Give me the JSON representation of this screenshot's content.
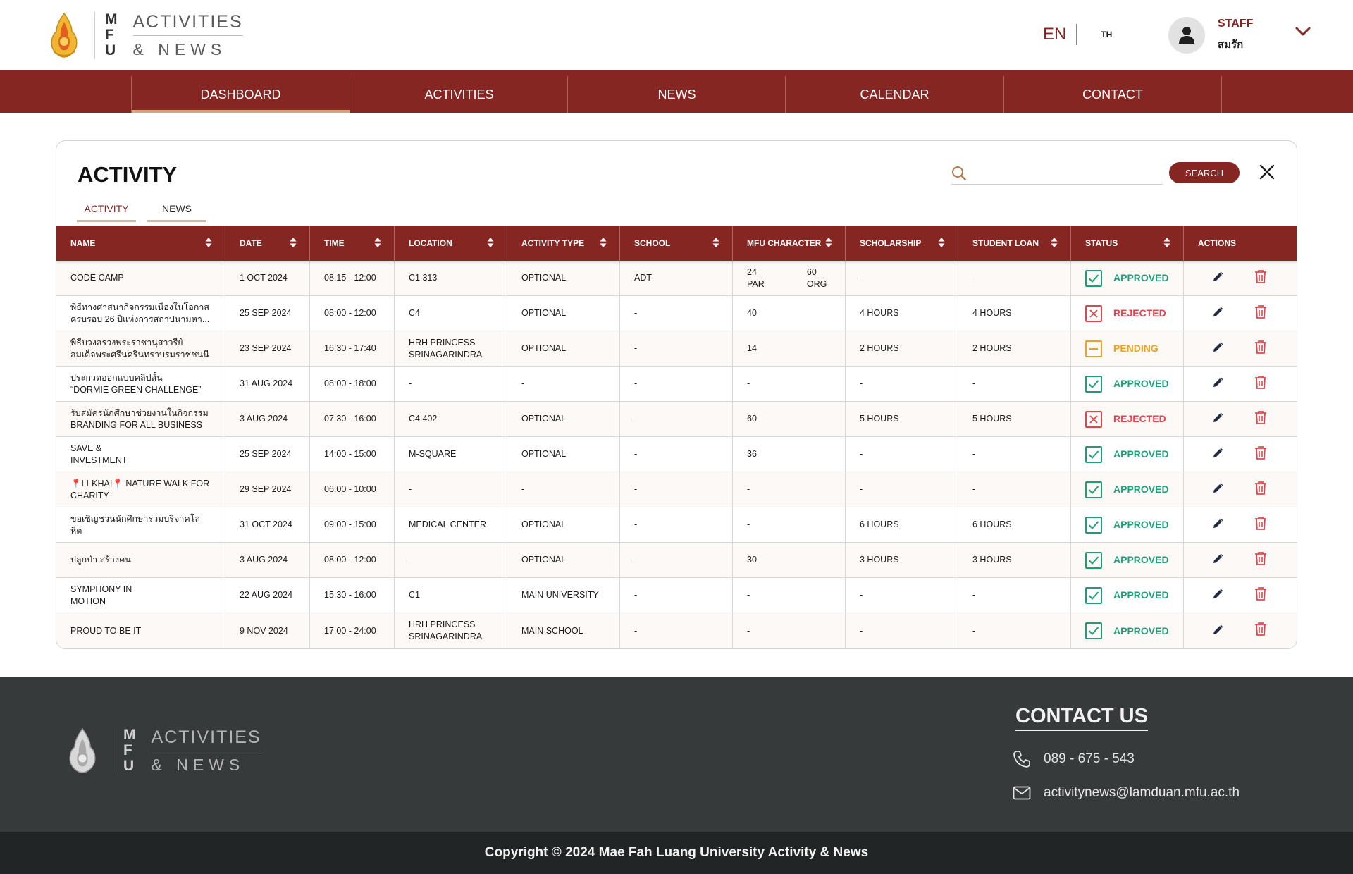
{
  "header": {
    "logo": {
      "letters": [
        "M",
        "F",
        "U"
      ],
      "line1": "ACTIVITIES",
      "line2": "& NEWS"
    },
    "lang": {
      "en": "EN",
      "th": "TH"
    },
    "user": {
      "role": "STAFF",
      "name": "สมรัก"
    }
  },
  "nav": [
    "DASHBOARD",
    "ACTIVITIES",
    "NEWS",
    "CALENDAR",
    "CONTACT"
  ],
  "nav_active": "DASHBOARD",
  "card": {
    "title": "ACTIVITY",
    "search": {
      "placeholder": "",
      "button": "SEARCH"
    },
    "tabs": [
      "ACTIVITY",
      "NEWS"
    ],
    "active_tab": "ACTIVITY"
  },
  "table": {
    "columns": [
      "NAME",
      "DATE",
      "TIME",
      "LOCATION",
      "ACTIVITY TYPE",
      "SCHOOL",
      "MFU CHARACTER",
      "SCHOLARSHIP",
      "STUDENT LOAN",
      "STATUS",
      "ACTIONS"
    ],
    "rows": [
      {
        "name": [
          "CODE CAMP"
        ],
        "date": "1 OCT 2024",
        "time": "08:15 - 12:00",
        "location": [
          "C1 313"
        ],
        "type": "OPTIONAL",
        "school": "ADT",
        "character": [
          "24 PAR",
          "60 ORG"
        ],
        "scholarship": "-",
        "loan": "-",
        "status": "APPROVED"
      },
      {
        "name": [
          "พิธีทางศาสนากิจกรรมเนื่องในโอกาส",
          "ครบรอบ 26 ปีแห่งการสถาปนามหา..."
        ],
        "date": "25 SEP 2024",
        "time": "08:00 - 12:00",
        "location": [
          "C4"
        ],
        "type": "OPTIONAL",
        "school": "-",
        "character": [
          "40"
        ],
        "scholarship": "4 HOURS",
        "loan": "4 HOURS",
        "status": "REJECTED"
      },
      {
        "name": [
          "พิธีบวงสรวงพระราชานุสาวรีย์",
          "สมเด็จพระศรีนครินทราบรมราชชนนี"
        ],
        "date": "23 SEP 2024",
        "time": "16:30 - 17:40",
        "location": [
          "HRH PRINCESS",
          "SRINAGARINDRA"
        ],
        "type": "OPTIONAL",
        "school": "-",
        "character": [
          "14"
        ],
        "scholarship": "2 HOURS",
        "loan": "2 HOURS",
        "status": "PENDING"
      },
      {
        "name": [
          "ประกวดออกแบบคลิปสั้น",
          "“DORMIE GREEN CHALLENGE”"
        ],
        "date": "31 AUG 2024",
        "time": "08:00 - 18:00",
        "location": [
          "-"
        ],
        "type": "-",
        "school": "-",
        "character": [
          "-"
        ],
        "scholarship": "-",
        "loan": "-",
        "status": "APPROVED"
      },
      {
        "name": [
          "รับสมัครนักศึกษาช่วยงานในกิจกรรม",
          "BRANDING FOR ALL BUSINESS"
        ],
        "date": "3 AUG 2024",
        "time": "07:30 - 16:00",
        "location": [
          "C4 402"
        ],
        "type": "OPTIONAL",
        "school": "-",
        "character": [
          "60"
        ],
        "scholarship": "5 HOURS",
        "loan": "5 HOURS",
        "status": "REJECTED"
      },
      {
        "name": [
          "SAVE &",
          "INVESTMENT"
        ],
        "date": "25 SEP 2024",
        "time": "14:00 - 15:00",
        "location": [
          "M-SQUARE"
        ],
        "type": "OPTIONAL",
        "school": "-",
        "character": [
          "36"
        ],
        "scholarship": "-",
        "loan": "-",
        "status": "APPROVED"
      },
      {
        "name": [
          "📍LI-KHAI📍 NATURE WALK FOR",
          "CHARITY"
        ],
        "date": "29 SEP 2024",
        "time": "06:00 - 10:00",
        "location": [
          "-"
        ],
        "type": "-",
        "school": "-",
        "character": [
          "-"
        ],
        "scholarship": "-",
        "loan": "-",
        "status": "APPROVED"
      },
      {
        "name": [
          "ขอเชิญชวนนักศึกษาร่วมบริจาคโล",
          "หิต"
        ],
        "date": "31 OCT 2024",
        "time": "09:00 - 15:00",
        "location": [
          "MEDICAL CENTER"
        ],
        "type": "OPTIONAL",
        "school": "-",
        "character": [
          "-"
        ],
        "scholarship": "6 HOURS",
        "loan": "6 HOURS",
        "status": "APPROVED"
      },
      {
        "name": [
          "ปลูกป่า สร้างคน"
        ],
        "date": "3 AUG 2024",
        "time": "08:00 - 12:00",
        "location": [
          "-"
        ],
        "type": "OPTIONAL",
        "school": "-",
        "character": [
          "30"
        ],
        "scholarship": "3 HOURS",
        "loan": "3 HOURS",
        "status": "APPROVED"
      },
      {
        "name": [
          "SYMPHONY IN",
          "MOTION"
        ],
        "date": "22 AUG 2024",
        "time": "15:30 - 16:00",
        "location": [
          "C1"
        ],
        "type": "MAIN UNIVERSITY",
        "school": "-",
        "character": [
          "-"
        ],
        "scholarship": "-",
        "loan": "-",
        "status": "APPROVED"
      },
      {
        "name": [
          "PROUD TO BE IT"
        ],
        "date": "9 NOV 2024",
        "time": "17:00 - 24:00",
        "location": [
          "HRH PRINCESS",
          "SRINAGARINDRA"
        ],
        "type": "MAIN SCHOOL",
        "school": "-",
        "character": [
          "-"
        ],
        "scholarship": "-",
        "loan": "-",
        "status": "APPROVED"
      }
    ]
  },
  "status_colors": {
    "APPROVED": "#1f9e7a",
    "REJECTED": "#e0474c",
    "PENDING": "#eea21f"
  },
  "icons": {
    "edit": "pencil-icon",
    "delete": "trash-icon",
    "sort": "sort-icon",
    "search": "search-icon",
    "close": "close-icon",
    "phone": "phone-icon",
    "email": "mail-icon"
  },
  "colors": {
    "brand": "#862622",
    "accent": "#d7a67a",
    "footer": "#363a3b"
  },
  "footer": {
    "logo": {
      "letters": [
        "M",
        "F",
        "U"
      ],
      "line1": "ACTIVITIES",
      "line2": "& NEWS"
    },
    "contact_title": "CONTACT US",
    "phone": "089 - 675 - 543",
    "email": "activitynews@lamduan.mfu.ac.th",
    "copyright": "Copyright © 2024 Mae Fah Luang University Activity & News"
  }
}
